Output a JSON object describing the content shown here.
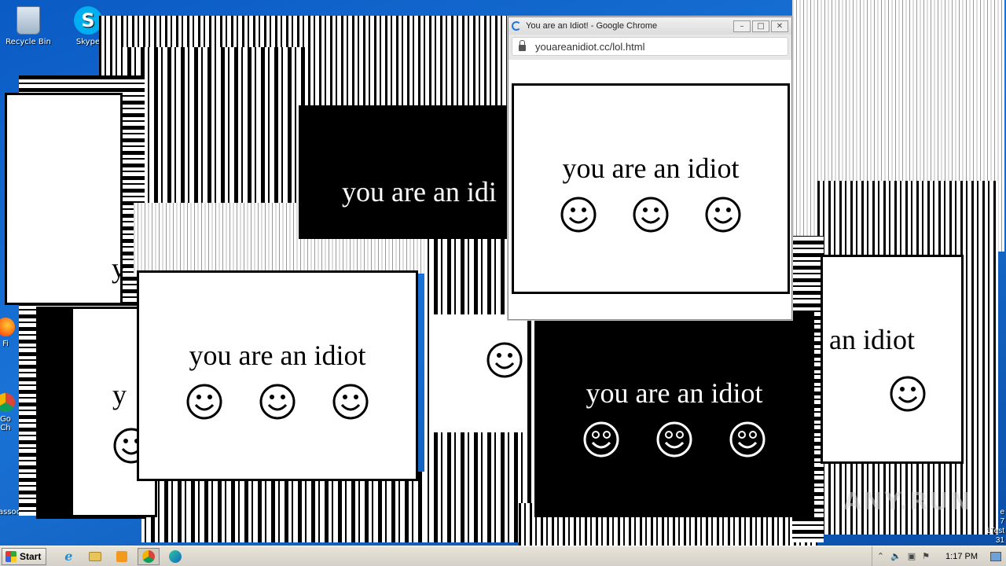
{
  "desktop": {
    "icons": [
      {
        "label": "Recycle Bin",
        "icon": "recycle-bin-icon"
      },
      {
        "label": "Skype",
        "icon": "skype-icon"
      },
      {
        "label": "Fi",
        "icon": "firefox-icon"
      },
      {
        "label": "Go\nCh",
        "icon": "chrome-icon"
      },
      {
        "label": "assoc",
        "icon": "file-icon"
      }
    ],
    "right_edge_text": [
      "e",
      "7",
      "1Test",
      "31"
    ]
  },
  "popup": {
    "message": "you are an idiot",
    "partial_message": "you are an idi",
    "partial_message_2": "an idiot",
    "partial_y": "y"
  },
  "chrome_window": {
    "title": "You are an Idiot! - Google Chrome",
    "url": "youareanidiot.cc/lol.html",
    "minimize": "–",
    "maximize": "□",
    "close": "✕"
  },
  "taskbar": {
    "start_label": "Start",
    "pinned": [
      "internet-explorer-icon",
      "file-explorer-icon",
      "media-player-icon",
      "chrome-icon",
      "edge-icon"
    ],
    "clock": "1:17 PM",
    "tray_icons": [
      "show-hidden-icons",
      "volume-icon",
      "network-icon",
      "flag-icon"
    ]
  },
  "watermark": "ANY.RUN",
  "colors": {
    "desktop_blue": "#1462b8",
    "popup_white": "#ffffff",
    "popup_black": "#000000",
    "chrome_accent": "#1a73e8"
  }
}
